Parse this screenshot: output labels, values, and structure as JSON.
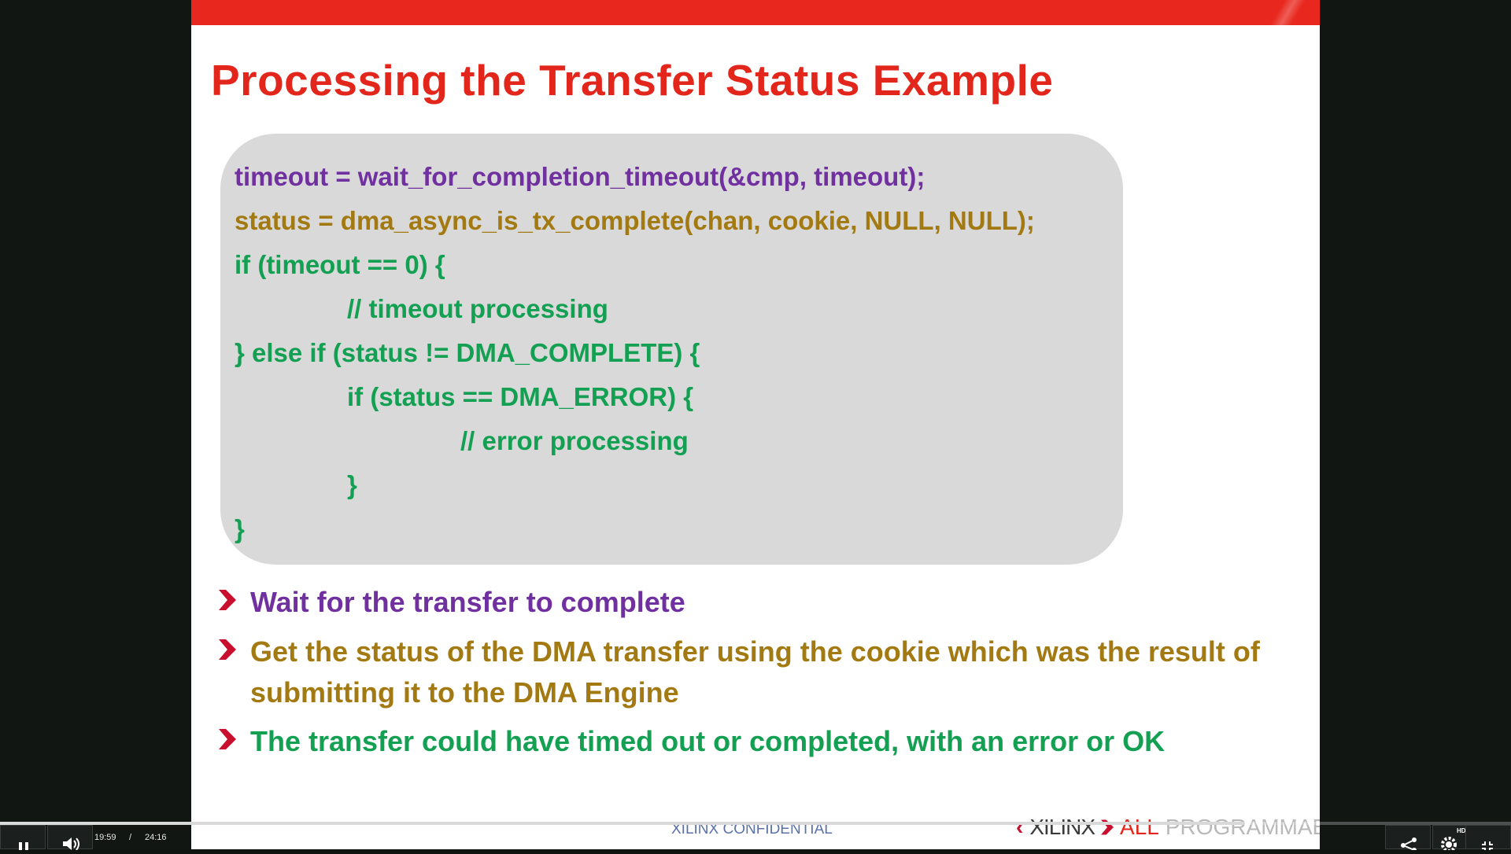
{
  "slide": {
    "title": "Processing the Transfer Status Example",
    "code_lines": [
      "timeout = wait_for_completion_timeout(&cmp,  timeout);",
      "status = dma_async_is_tx_complete(chan,  cookie, NULL, NULL);",
      "if (timeout == 0)  {",
      "// timeout processing",
      "} else if (status != DMA_COMPLETE) {",
      "if (status == DMA_ERROR) {",
      "// error processing",
      "}",
      "}"
    ],
    "bullets": [
      "Wait for the transfer to complete",
      "Get the status of the DMA transfer using the cookie which was the result of submitting it to the DMA Engine",
      "The transfer could have timed out or completed, with an error or OK"
    ],
    "footer_confidential": "XILINX CONFIDENTIAL",
    "brand": {
      "name": "XILINX",
      "tagline_1": "ALL",
      "tagline_2": "PROGRAMMABLE."
    },
    "colors": {
      "title": "#e3261c",
      "purple": "#7030a0",
      "gold": "#a37a12",
      "green": "#14a052",
      "code_bg": "#d9d9d9"
    }
  },
  "player": {
    "current_time": "19:59",
    "separator": "/",
    "duration": "24:16",
    "progress_fraction": 0.823,
    "hd_badge": "HD",
    "icons": {
      "play_pause": "pause-icon",
      "volume": "volume-icon",
      "share": "share-icon",
      "settings": "gear-icon",
      "fullscreen": "exit-fullscreen-icon"
    }
  }
}
